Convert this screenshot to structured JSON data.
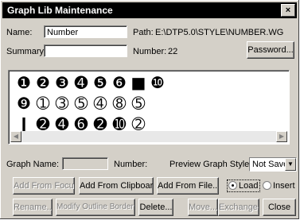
{
  "window": {
    "title": "Graph Lib Maintenance",
    "close_label": "×"
  },
  "form": {
    "name_label": "Name:",
    "name_value": "Number",
    "path_label": "Path:",
    "path_value": "E:\\DTP5.0\\STYLE\\NUMBER.WG",
    "summary_label": "Summary:",
    "summary_value": "",
    "number_label": "Number:",
    "number_value": "22",
    "password_button": "Password..."
  },
  "glyphs": [
    "icon-1",
    "icon-2",
    "icon-3",
    "icon-4",
    "icon-5",
    "icon-6",
    "icon-7",
    "icon-8",
    "icon-9",
    "icon-10",
    "icon-11",
    "icon-12",
    "icon-13",
    "icon-14",
    "icon-15",
    "icon-16",
    "icon-17",
    "icon-18",
    "icon-19",
    "icon-20",
    "icon-21",
    "icon-22"
  ],
  "graph": {
    "graph_name_label": "Graph Name:",
    "graph_name_value": "",
    "number_label": "Number:",
    "preview_label": "Preview Graph Style:",
    "preview_value": "Not Save"
  },
  "buttons": {
    "add_from_focus": "Add From Focus",
    "add_from_clipboard": "Add From Clipboard",
    "add_from_file": "Add From File...",
    "load": "Load",
    "insert": "Insert",
    "rename": "Rename...",
    "modify_outline": "Modify Outline Border...",
    "delete": "Delete...",
    "move": "Move...",
    "exchange": "Exchange...",
    "close": "Close"
  },
  "mode": {
    "selected": "Load"
  }
}
